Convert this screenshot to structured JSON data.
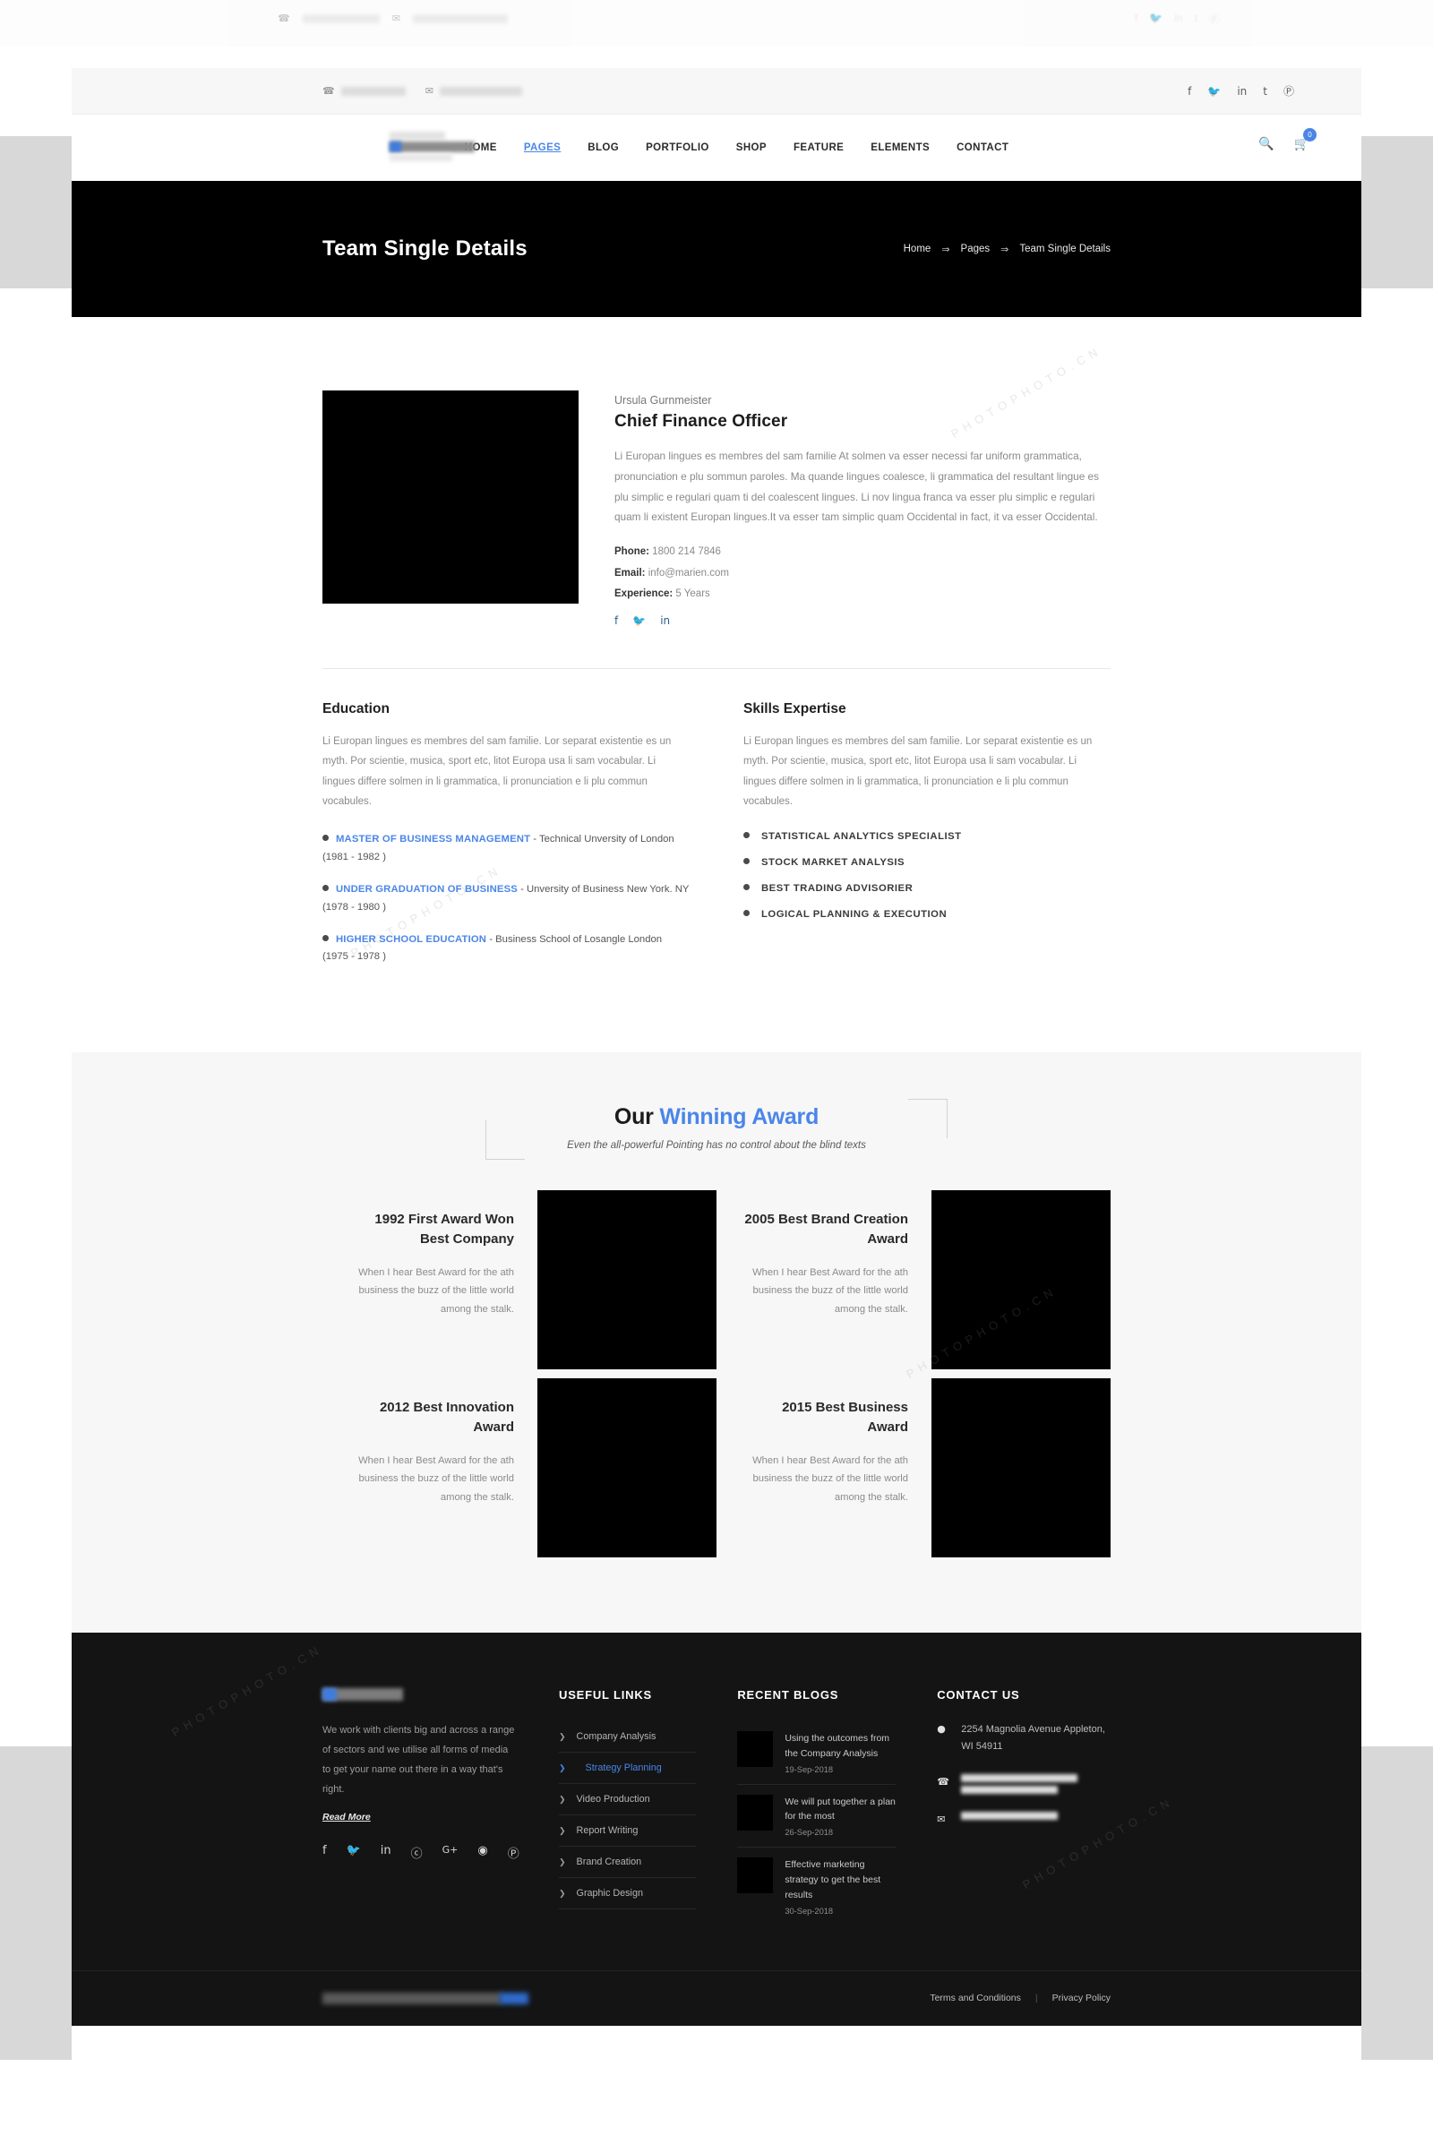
{
  "topbar": {
    "phone_icon": "phone-icon",
    "mail_icon": "mail-icon",
    "phone_masked": "",
    "email_masked": "",
    "socials": [
      "f",
      "ᵛ",
      "in",
      "t",
      "ⓟ"
    ]
  },
  "nav": {
    "items": [
      {
        "label": "HOME",
        "active": false
      },
      {
        "label": "PAGES",
        "active": true
      },
      {
        "label": "BLOG",
        "active": false
      },
      {
        "label": "PORTFOLIO",
        "active": false
      },
      {
        "label": "SHOP",
        "active": false
      },
      {
        "label": "FEATURE",
        "active": false
      },
      {
        "label": "ELEMENTS",
        "active": false
      },
      {
        "label": "CONTACT",
        "active": false
      }
    ],
    "cart_count": "0",
    "accent": "#4a86e8"
  },
  "hero": {
    "title": "Team Single Details",
    "crumb_home": "Home",
    "crumb_pages": "Pages",
    "crumb_current": "Team Single Details",
    "sep": "⇒"
  },
  "profile": {
    "name": "Ursula Gurnmeister",
    "role": "Chief Finance Officer",
    "bio": "Li Europan lingues es membres del sam familie At solmen va esser necessi far uniform grammatica, pronunciation e plu sommun paroles. Ma quande lingues coalesce, li grammatica del resultant lingue es plu simplic e regulari quam ti del coalescent lingues. Li nov lingua franca va esser plu simplic e regulari quam li existent Europan lingues.It va esser tam simplic quam Occidental in fact, it va esser Occidental.",
    "phone_label": "Phone:",
    "phone_value": " 1800 214  7846",
    "email_label": "Email:",
    "email_value": " info@marien.com",
    "experience_label": "Experience:",
    "experience_value": " 5 Years",
    "socials": [
      "f",
      "ᵛ",
      "in"
    ]
  },
  "education": {
    "heading": "Education",
    "intro": "Li Europan lingues es membres del sam familie. Lor separat existentie es un myth. Por scientie, musica, sport etc, litot Europa usa li sam vocabular. Li lingues differe solmen in li grammatica, li pronunciation e li plu commun vocabules.",
    "items": [
      {
        "title": "MASTER OF BUSINESS MANAGEMENT",
        "detail": " - Technical Unversity of London (1981 - 1982 )"
      },
      {
        "title": "UNDER GRADUATION OF BUSINESS",
        "detail": " - Unversity of Business New York. NY (1978 - 1980 )"
      },
      {
        "title": "HIGHER SCHOOL EDUCATION",
        "detail": " - Business School of Losangle London (1975 - 1978 )"
      }
    ]
  },
  "skills": {
    "heading": "Skills Expertise",
    "intro": "Li Europan lingues es membres del sam familie. Lor separat existentie es un myth. Por scientie, musica, sport etc, litot Europa usa li sam vocabular. Li lingues differe solmen in li grammatica, li pronunciation e li plu commun vocabules.",
    "items": [
      "STATISTICAL ANALYTICS SPECIALIST",
      "STOCK MARKET ANALYSIS",
      "BEST TRADING ADVISORIER",
      "LOGICAL PLANNING & EXECUTION"
    ]
  },
  "awards": {
    "title_plain": "Our ",
    "title_accent": "Winning Award",
    "subtitle": "Even the all-powerful Pointing has no control about the blind texts",
    "cards": [
      {
        "title": "1992 First Award Won Best Company",
        "text": "When I hear Best Award for the  ath business the buzz of the little world among the stalk."
      },
      {
        "title": "2005 Best Brand Creation Award",
        "text": "When I hear Best Award for the  ath business the buzz of the little world among the stalk."
      },
      {
        "title": "2012 Best Innovation Award",
        "text": "When I hear Best Award for the  ath business the buzz of the little world among the stalk."
      },
      {
        "title": "2015 Best Business Award",
        "text": "When I hear Best Award for the  ath business the buzz of the little world among the stalk."
      }
    ]
  },
  "footer": {
    "about_text": "We work with clients big and across a range of sectors and we utilise all forms of media to get your name out there in a way that's right.",
    "read_more": "Read More",
    "socials": [
      "f",
      "ᵛ",
      "in",
      "ⓢ",
      "G+",
      "◉",
      "ⓟ"
    ],
    "useful_links_heading": "USEFUL LINKS",
    "useful_links": [
      {
        "label": "Company Analysis",
        "active": false
      },
      {
        "label": "Strategy Planning",
        "active": true
      },
      {
        "label": "Video Production",
        "active": false
      },
      {
        "label": "Report Writing",
        "active": false
      },
      {
        "label": "Brand Creation",
        "active": false
      },
      {
        "label": "Graphic Design",
        "active": false
      }
    ],
    "blogs_heading": "RECENT BLOGS",
    "blogs": [
      {
        "title": "Using the outcomes from the Company Analysis",
        "date": "19-Sep-2018"
      },
      {
        "title": "We will put together a plan for the most",
        "date": "26-Sep-2018"
      },
      {
        "title": "Effective marketing strategy to get the best results",
        "date": "30-Sep-2018"
      }
    ],
    "contact_heading": "CONTACT US",
    "address": "2254 Magnolia Avenue Appleton, WI 54911",
    "phone_masked": "",
    "email_masked": "",
    "terms": "Terms and Conditions",
    "privacy": "Privacy Policy",
    "legal_sep": "|"
  },
  "watermark": {
    "text": "PHOTOPHOTO.CN"
  }
}
